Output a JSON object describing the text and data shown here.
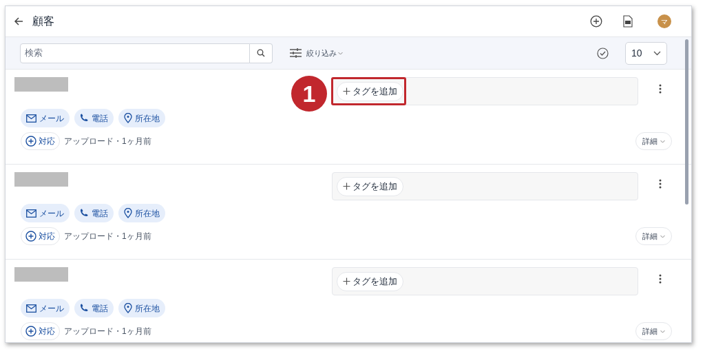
{
  "header": {
    "title": "顧客",
    "avatar_initial": "マ"
  },
  "toolbar": {
    "search_placeholder": "検索",
    "filter_label": "絞り込み",
    "page_size": "10"
  },
  "customers": [
    {
      "name_redacted": true,
      "tag_button": "タグを追加",
      "contacts": [
        {
          "kind": "email",
          "label": "メール"
        },
        {
          "kind": "phone",
          "label": "電話"
        },
        {
          "kind": "location",
          "label": "所在地"
        }
      ],
      "action": "対応",
      "meta": "アップロード・1ヶ月前",
      "details": "詳細",
      "annotation": "1"
    },
    {
      "name_redacted": true,
      "tag_button": "タグを追加",
      "contacts": [
        {
          "kind": "email",
          "label": "メール"
        },
        {
          "kind": "phone",
          "label": "電話"
        },
        {
          "kind": "location",
          "label": "所在地"
        }
      ],
      "action": "対応",
      "meta": "アップロード・1ヶ月前",
      "details": "詳細"
    },
    {
      "name_redacted": true,
      "tag_button": "タグを追加",
      "contacts": [
        {
          "kind": "email",
          "label": "メール"
        },
        {
          "kind": "phone",
          "label": "電話"
        },
        {
          "kind": "location",
          "label": "所在地"
        }
      ],
      "action": "対応",
      "meta": "アップロード・1ヶ月前",
      "details": "詳細"
    }
  ]
}
